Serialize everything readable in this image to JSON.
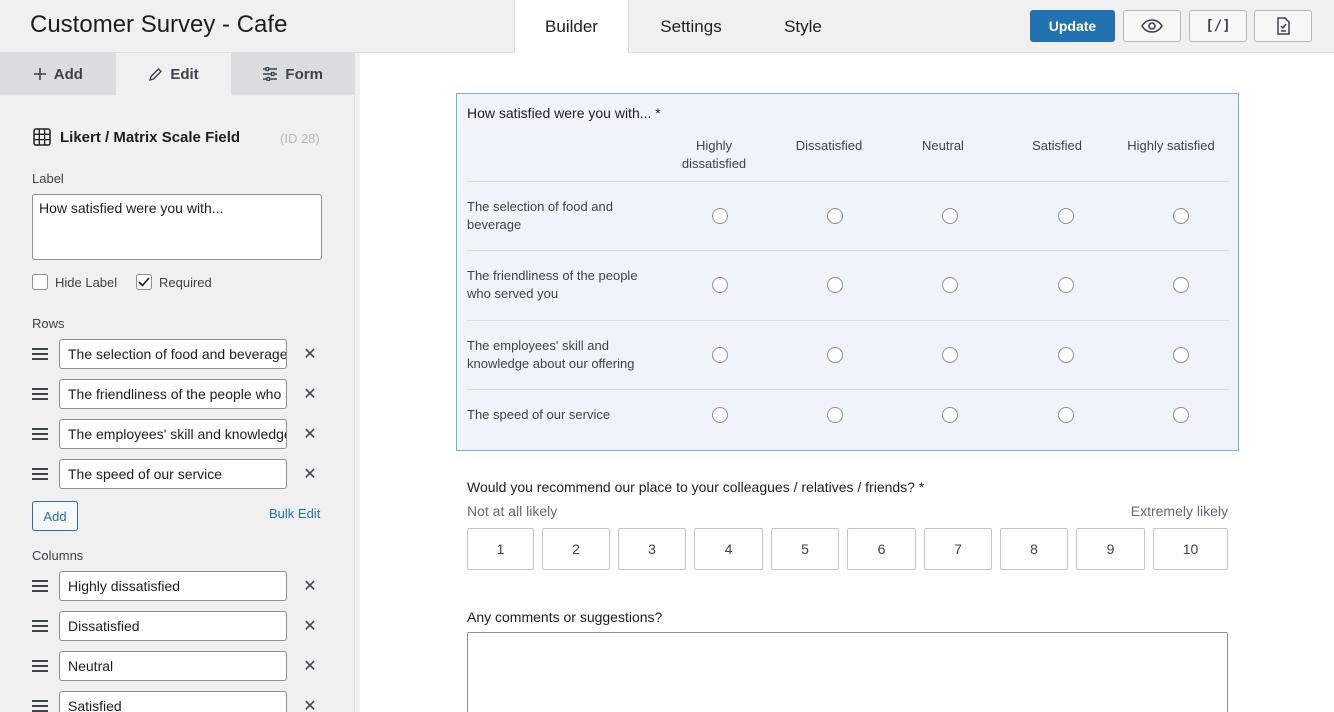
{
  "header": {
    "title": "Customer Survey - Cafe",
    "tabs": [
      "Builder",
      "Settings",
      "Style"
    ],
    "update_label": "Update",
    "embed_label": "[/]",
    "icons": {
      "preview": "eye-icon",
      "entries": "clipboard-icon"
    }
  },
  "sidebar": {
    "tabs": [
      {
        "label": "Add",
        "icon": "plus-icon"
      },
      {
        "label": "Edit",
        "icon": "pencil-icon"
      },
      {
        "label": "Form",
        "icon": "sliders-icon"
      }
    ],
    "field_title": "Likert / Matrix Scale Field",
    "field_id": "(ID 28)",
    "label_heading": "Label",
    "label_value": "How satisfied were you with...",
    "hide_label": "Hide Label",
    "required": "Required",
    "hide_label_checked": false,
    "required_checked": true,
    "rows_heading": "Rows",
    "rows": [
      "The selection of food and beverage",
      "The friendliness of the people who served you",
      "The employees' skill and knowledge about our offering",
      "The speed of our service"
    ],
    "add_label": "Add",
    "bulk_edit_label": "Bulk Edit",
    "columns_heading": "Columns",
    "columns": [
      "Highly dissatisfied",
      "Dissatisfied",
      "Neutral",
      "Satisfied"
    ]
  },
  "canvas": {
    "likert": {
      "question": "How satisfied were you with... *",
      "columns": [
        {
          "line1": "Highly",
          "line2": "dissatisfied"
        },
        {
          "line1": "Dissatisfied",
          "line2": ""
        },
        {
          "line1": "Neutral",
          "line2": ""
        },
        {
          "line1": "Satisfied",
          "line2": ""
        },
        {
          "line1": "Highly satisfied",
          "line2": ""
        }
      ],
      "rows": [
        {
          "line1": "The selection of food and",
          "line2": "beverage"
        },
        {
          "line1": "The friendliness of the people",
          "line2": "who served you"
        },
        {
          "line1": "The employees' skill and",
          "line2": "knowledge about our offering"
        },
        {
          "line1": "The speed of our service",
          "line2": ""
        }
      ]
    },
    "nps": {
      "question": "Would you recommend our place to your colleagues / relatives / friends? *",
      "low_label": "Not at all likely",
      "high_label": "Extremely likely",
      "options": [
        "1",
        "2",
        "3",
        "4",
        "5",
        "6",
        "7",
        "8",
        "9",
        "10"
      ]
    },
    "comments": {
      "question": "Any comments or suggestions?"
    }
  }
}
